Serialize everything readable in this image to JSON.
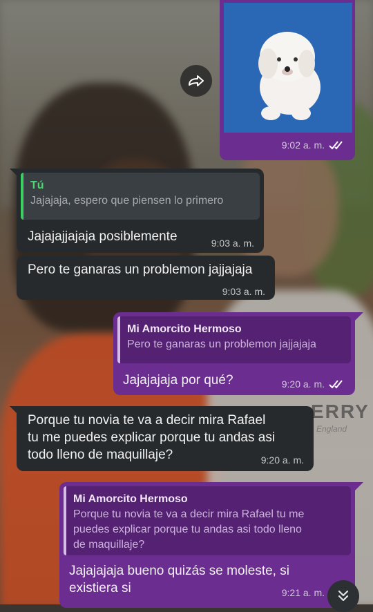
{
  "messages": {
    "image_msg": {
      "time": "9:02 a. m."
    },
    "msg1": {
      "quote_author": "Tú",
      "quote_text": "Jajajaja, espero que piensen lo primero",
      "text": "Jajajajjajaja posiblemente",
      "time": "9:03 a. m."
    },
    "msg2": {
      "text": "Pero te ganaras un problemon jajjajaja",
      "time": "9:03 a. m."
    },
    "msg3": {
      "quote_author": "Mi Amorcito Hermoso",
      "quote_text": "Pero te ganaras un problemon jajjajaja",
      "text": "Jajajajaja por qué?",
      "time": "9:20 a. m."
    },
    "msg4": {
      "text_line1": "Porque  tu novia te  va a decir mira Rafael",
      "text_line2": "tu me puedes explicar porque tu andas asi",
      "text_line3": "todo lleno de maquillaje?",
      "time": "9:20 a. m."
    },
    "msg5": {
      "quote_author": "Mi Amorcito Hermoso",
      "quote_line1": "Porque  tu novia te  va a decir mira Rafael tu me",
      "quote_line2": "puedes explicar porque tu andas asi todo lleno",
      "quote_line3": "de maquillaje?",
      "text_line1": "Jajajajaja bueno quizás se moleste, si",
      "text_line2": "existiera si",
      "time": "9:21 a. m."
    }
  },
  "wallpaper": {
    "shirt_text": "ERRY",
    "shirt_subtext": "England"
  },
  "icons": {
    "forward": "forward-icon",
    "scroll_down": "double-chevron-down-icon",
    "read_ticks": "double-check-icon"
  },
  "colors": {
    "outgoing_bubble": "#6b2d8f",
    "incoming_bubble": "#262a2d",
    "quote_bar_in": "#3ecf62"
  }
}
